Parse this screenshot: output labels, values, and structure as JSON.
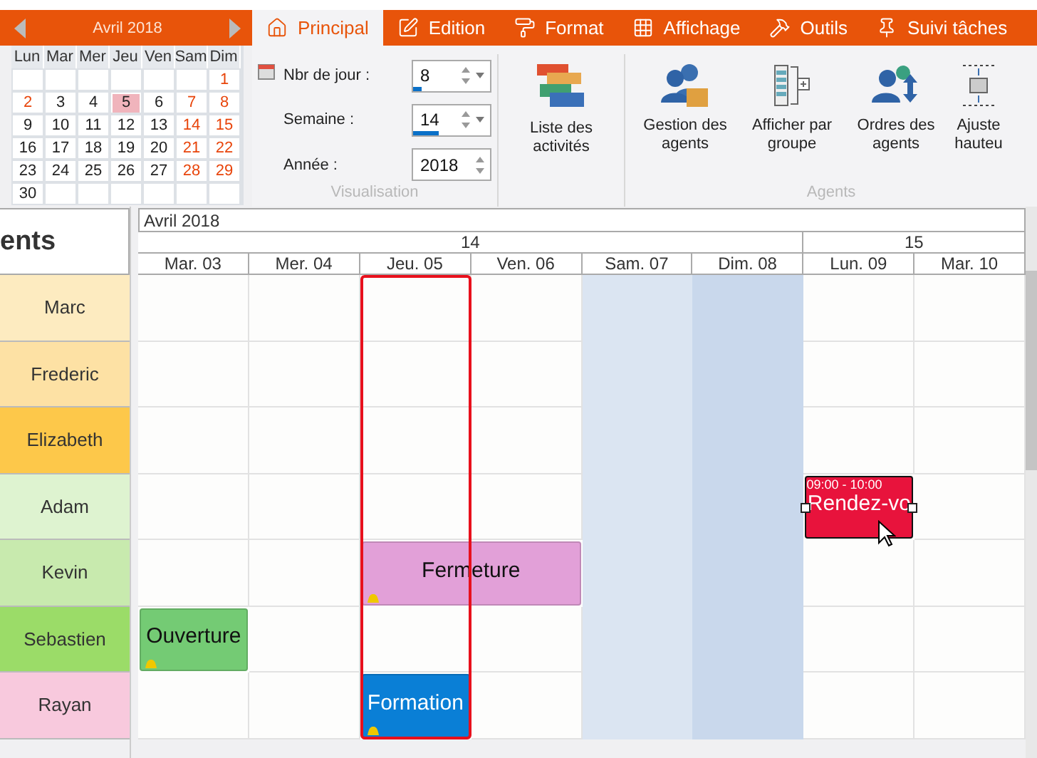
{
  "mini_calendar": {
    "title": "Avril 2018",
    "weekdays": [
      "Lun",
      "Mar",
      "Mer",
      "Jeu",
      "Ven",
      "Sam",
      "Dim"
    ],
    "days": [
      {
        "label": "1",
        "red": true,
        "selected": false
      },
      {
        "label": "2",
        "red": true,
        "selected": false
      },
      {
        "label": "3",
        "red": false,
        "selected": false
      },
      {
        "label": "4",
        "red": false,
        "selected": false
      },
      {
        "label": "5",
        "red": false,
        "selected": true
      },
      {
        "label": "6",
        "red": false,
        "selected": false
      },
      {
        "label": "7",
        "red": true,
        "selected": false
      },
      {
        "label": "8",
        "red": true,
        "selected": false
      },
      {
        "label": "9",
        "red": false,
        "selected": false
      },
      {
        "label": "10",
        "red": false,
        "selected": false
      },
      {
        "label": "11",
        "red": false,
        "selected": false
      },
      {
        "label": "12",
        "red": false,
        "selected": false
      },
      {
        "label": "13",
        "red": false,
        "selected": false
      },
      {
        "label": "14",
        "red": true,
        "selected": false
      },
      {
        "label": "15",
        "red": true,
        "selected": false
      },
      {
        "label": "16",
        "red": false,
        "selected": false
      },
      {
        "label": "17",
        "red": false,
        "selected": false
      },
      {
        "label": "18",
        "red": false,
        "selected": false
      },
      {
        "label": "19",
        "red": false,
        "selected": false
      },
      {
        "label": "20",
        "red": false,
        "selected": false
      },
      {
        "label": "21",
        "red": true,
        "selected": false
      },
      {
        "label": "22",
        "red": true,
        "selected": false
      },
      {
        "label": "23",
        "red": false,
        "selected": false
      },
      {
        "label": "24",
        "red": false,
        "selected": false
      },
      {
        "label": "25",
        "red": false,
        "selected": false
      },
      {
        "label": "26",
        "red": false,
        "selected": false
      },
      {
        "label": "27",
        "red": false,
        "selected": false
      },
      {
        "label": "28",
        "red": true,
        "selected": false
      },
      {
        "label": "29",
        "red": true,
        "selected": false
      },
      {
        "label": "30",
        "red": false,
        "selected": false
      }
    ]
  },
  "tabs": [
    {
      "label": "Principal",
      "selected": true
    },
    {
      "label": "Edition",
      "selected": false
    },
    {
      "label": "Format",
      "selected": false
    },
    {
      "label": "Affichage",
      "selected": false
    },
    {
      "label": "Outils",
      "selected": false
    },
    {
      "label": "Suivi tâches",
      "selected": false
    }
  ],
  "visualisation": {
    "label": "Visualisation",
    "fields": [
      {
        "label": "Nbr de jour :",
        "value": "8",
        "dropdown": true,
        "level": 0.12
      },
      {
        "label": "Semaine :",
        "value": "14",
        "dropdown": true,
        "level": 0.33
      },
      {
        "label": "Année :",
        "value": "2018",
        "dropdown": false
      }
    ]
  },
  "activities_button": {
    "label": "Liste des activités"
  },
  "agents_group": {
    "label": "Agents",
    "buttons": [
      {
        "label": "Gestion des agents"
      },
      {
        "label": "Afficher par groupe"
      },
      {
        "label": "Ordres des agents"
      },
      {
        "label": "Ajuste hauteu"
      }
    ]
  },
  "agents_header": "ents",
  "schedule": {
    "month": "Avril 2018",
    "weeks": [
      {
        "label": "14",
        "days": [
          {
            "label": "Mar. 03",
            "weekend": false,
            "today": false
          },
          {
            "label": "Mer. 04",
            "weekend": false,
            "today": false
          },
          {
            "label": "Jeu. 05",
            "weekend": false,
            "today": true
          },
          {
            "label": "Ven. 06",
            "weekend": false,
            "today": false
          },
          {
            "label": "Sam. 07",
            "weekend": true,
            "today": false
          },
          {
            "label": "Dim. 08",
            "weekend": true,
            "today": false
          }
        ]
      },
      {
        "label": "15",
        "days": [
          {
            "label": "Lun. 09",
            "weekend": false,
            "today": false
          },
          {
            "label": "Mar. 10",
            "weekend": false,
            "today": false
          }
        ]
      }
    ]
  },
  "agents": [
    {
      "name": "Marc",
      "color": "#fdebc0",
      "slots": [
        {
          "kind": "free"
        },
        {
          "kind": "free"
        },
        {
          "kind": "free"
        },
        {
          "kind": "free"
        },
        {
          "kind": "free"
        },
        {
          "kind": "free"
        },
        {
          "kind": "free"
        },
        {
          "kind": "free"
        }
      ]
    },
    {
      "name": "Frederic",
      "color": "#fde1a4",
      "slots": [
        {
          "kind": "free"
        },
        {
          "kind": "free"
        },
        {
          "kind": "free"
        },
        {
          "kind": "free"
        },
        {
          "kind": "free"
        },
        {
          "kind": "free"
        },
        {
          "kind": "free"
        },
        {
          "kind": "free"
        }
      ]
    },
    {
      "name": "Elizabeth",
      "color": "#fdc84a",
      "slots": [
        {
          "kind": "free"
        },
        {
          "kind": "free"
        },
        {
          "kind": "free"
        },
        {
          "kind": "free"
        },
        {
          "kind": "free"
        },
        {
          "kind": "free"
        },
        {
          "kind": "free"
        },
        {
          "kind": "free"
        }
      ]
    },
    {
      "name": "Adam",
      "color": "#def3d0",
      "slots": [
        {
          "kind": "free"
        },
        {
          "kind": "free"
        },
        {
          "kind": "free"
        },
        {
          "kind": "free"
        },
        {
          "kind": "free"
        },
        {
          "kind": "free"
        },
        {
          "kind": "event",
          "title": "Rendez-vo",
          "time": "09:00 - 10:00",
          "color": "#e8133c",
          "selected": true,
          "alert": false
        },
        {
          "kind": "free"
        }
      ]
    },
    {
      "name": "Kevin",
      "color": "#c8eaae",
      "slots": [
        {
          "kind": "free"
        },
        {
          "kind": "free"
        },
        {
          "kind": "event",
          "title": "Fermeture",
          "color": "#e2a0d8",
          "selected": false,
          "alert": true
        },
        {
          "kind": "continued"
        },
        {
          "kind": "free"
        },
        {
          "kind": "free"
        },
        {
          "kind": "free"
        },
        {
          "kind": "free"
        }
      ]
    },
    {
      "name": "Sebastien",
      "color": "#9bdc68",
      "slots": [
        {
          "kind": "event",
          "title": "Ouverture",
          "color": "#74cb74",
          "selected": false,
          "alert": true
        },
        {
          "kind": "free"
        },
        {
          "kind": "free"
        },
        {
          "kind": "free"
        },
        {
          "kind": "free"
        },
        {
          "kind": "free"
        },
        {
          "kind": "free"
        },
        {
          "kind": "free"
        }
      ]
    },
    {
      "name": "Rayan",
      "color": "#f8c9dd",
      "slots": [
        {
          "kind": "free"
        },
        {
          "kind": "free"
        },
        {
          "kind": "event",
          "title": "Formation",
          "color": "#0a7fd6",
          "selected": false,
          "alert": true
        },
        {
          "kind": "free"
        },
        {
          "kind": "free"
        },
        {
          "kind": "free"
        },
        {
          "kind": "free"
        },
        {
          "kind": "free"
        }
      ]
    }
  ]
}
